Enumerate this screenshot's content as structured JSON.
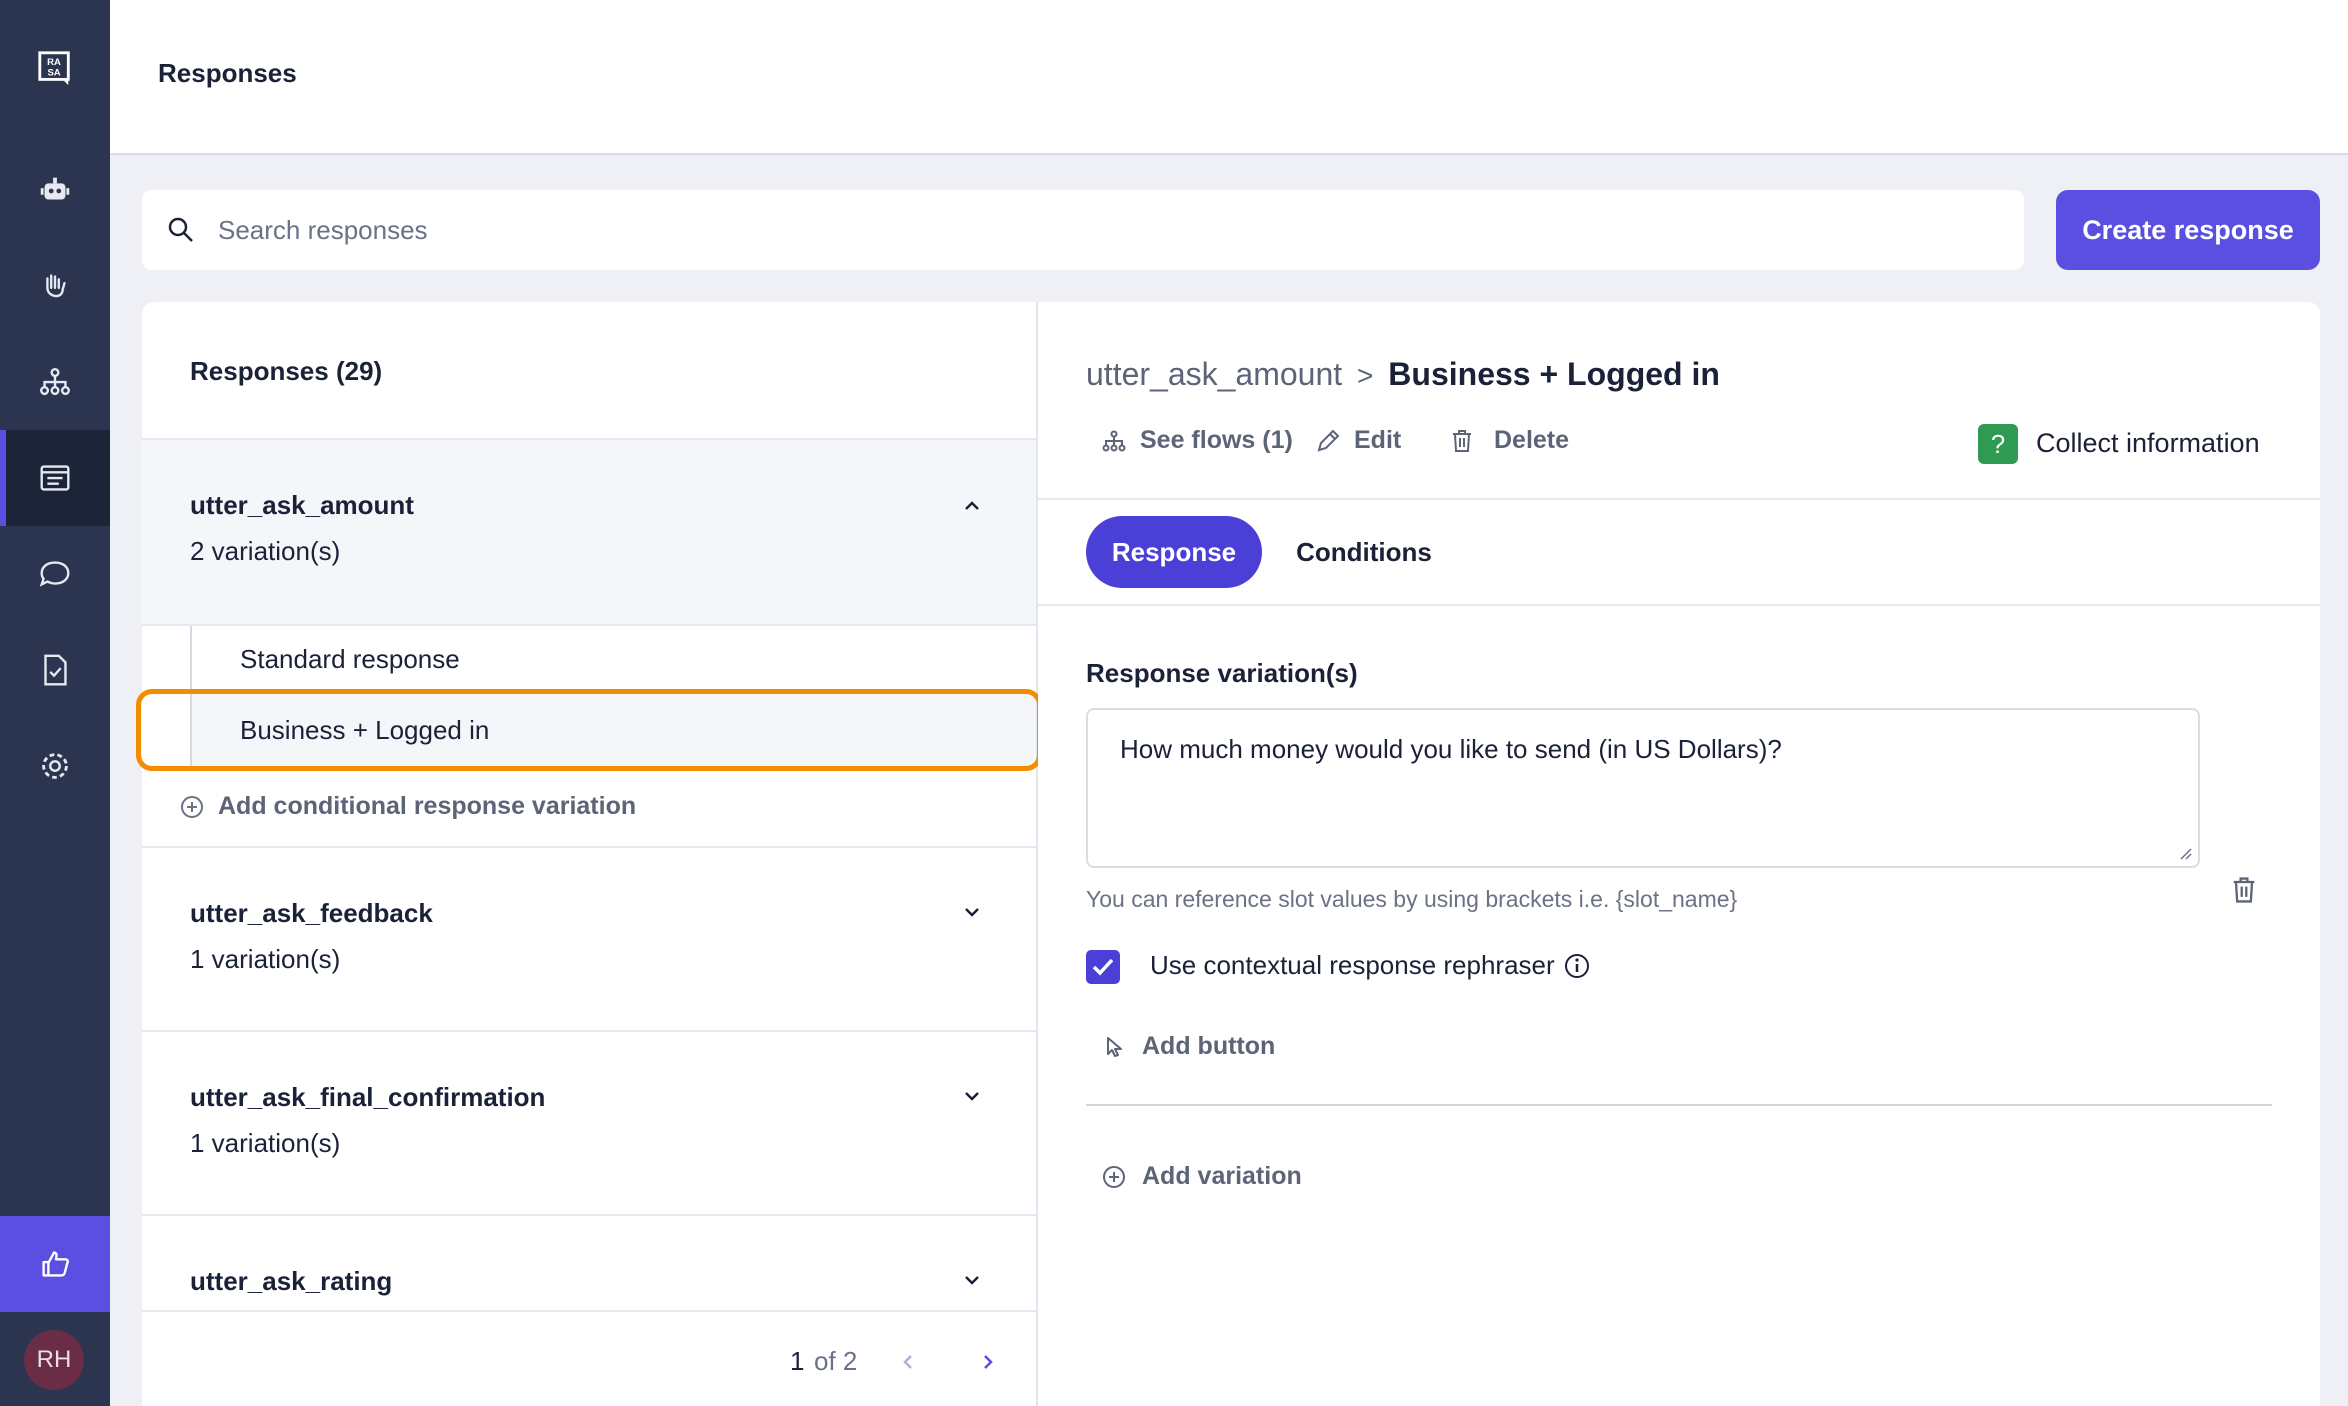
{
  "header": {
    "title": "Responses"
  },
  "sidebar": {
    "logo": "rasa-logo",
    "items": [
      {
        "icon": "robot-icon"
      },
      {
        "icon": "hand-wave-icon"
      },
      {
        "icon": "flows-icon"
      },
      {
        "icon": "responses-icon",
        "active": true
      },
      {
        "icon": "chat-bubble-icon"
      },
      {
        "icon": "document-check-icon"
      },
      {
        "icon": "gear-icon"
      }
    ],
    "feedback_icon": "thumbs-up-icon",
    "avatar": "RH"
  },
  "search": {
    "placeholder": "Search responses",
    "value": ""
  },
  "create_button": "Create response",
  "list": {
    "heading": "Responses (29)",
    "items": [
      {
        "name": "utter_ask_amount",
        "variations": "2 variation(s)",
        "expanded": true,
        "children": [
          "Standard response",
          "Business + Logged in"
        ],
        "add_label": "Add conditional response variation"
      },
      {
        "name": "utter_ask_feedback",
        "variations": "1 variation(s)"
      },
      {
        "name": "utter_ask_final_confirmation",
        "variations": "1 variation(s)"
      },
      {
        "name": "utter_ask_rating",
        "variations": ""
      }
    ],
    "pagination": {
      "current": "1",
      "of_label": "of 2"
    }
  },
  "detail": {
    "breadcrumb_parent": "utter_ask_amount",
    "breadcrumb_sep": ">",
    "breadcrumb_current": "Business + Logged in",
    "actions": {
      "see_flows": "See flows (1)",
      "edit": "Edit",
      "delete": "Delete"
    },
    "collect": {
      "badge": "?",
      "label": "Collect information"
    },
    "tabs": [
      {
        "label": "Response",
        "active": true
      },
      {
        "label": "Conditions"
      }
    ],
    "section_title": "Response variation(s)",
    "response_text": "How much money would you like to send (in US Dollars)?",
    "hint": "You can reference slot values by using brackets i.e. {slot_name}",
    "rephraser_label": "Use contextual response rephraser",
    "rephraser_checked": true,
    "add_button": "Add button",
    "add_variation": "Add variation"
  },
  "colors": {
    "accent": "#5a4fe0",
    "sidebar": "#2b3550",
    "highlight": "#f28c00",
    "badge": "#2e9a52"
  }
}
